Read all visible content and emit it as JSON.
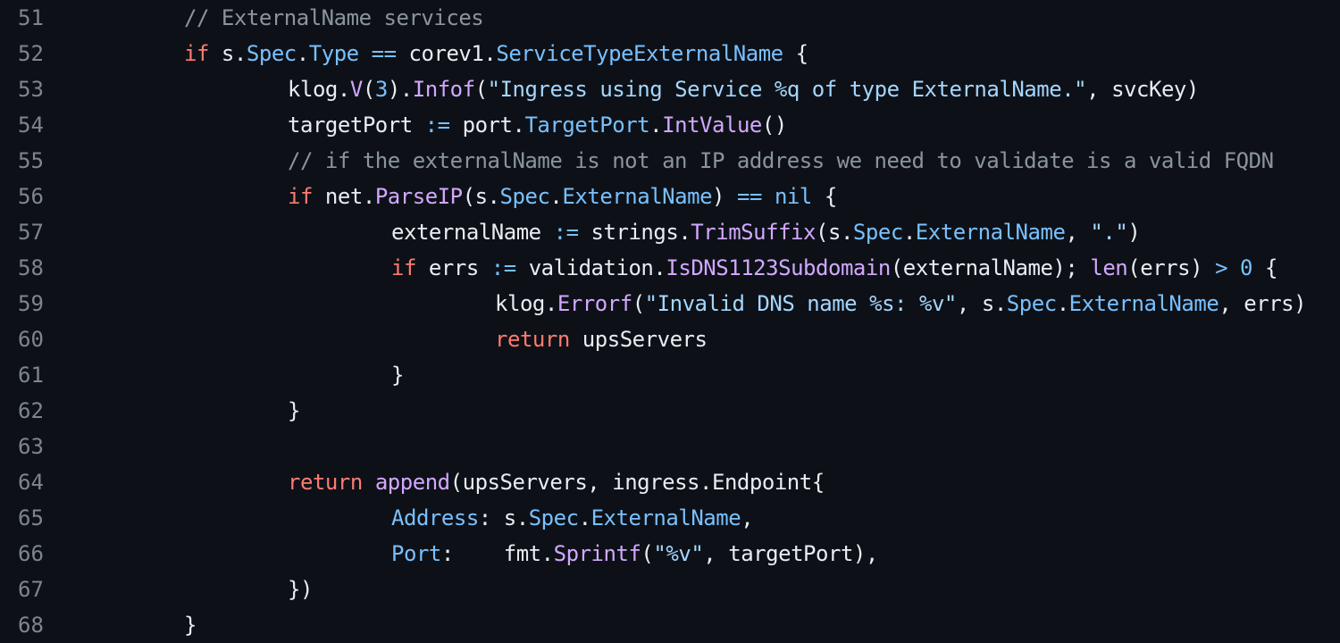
{
  "colors": {
    "background": "#0d1117",
    "line_number": "#7d8590",
    "plain": "#e6edf3",
    "comment": "#8b949e",
    "keyword": "#ff7b72",
    "operator": "#79c0ff",
    "type": "#79c0ff",
    "function": "#d2a8ff",
    "string": "#a5d6ff",
    "number": "#79c0ff"
  },
  "lines": [
    {
      "number": "51",
      "indent": 0,
      "tokens": [
        {
          "t": "// ExternalName services",
          "c": "comment"
        }
      ]
    },
    {
      "number": "52",
      "indent": 0,
      "tokens": [
        {
          "t": "if",
          "c": "keyword"
        },
        {
          "t": " s.",
          "c": "plain"
        },
        {
          "t": "Spec",
          "c": "type"
        },
        {
          "t": ".",
          "c": "plain"
        },
        {
          "t": "Type",
          "c": "type"
        },
        {
          "t": " ",
          "c": "plain"
        },
        {
          "t": "==",
          "c": "operator"
        },
        {
          "t": " corev1.",
          "c": "plain"
        },
        {
          "t": "ServiceTypeExternalName",
          "c": "type"
        },
        {
          "t": " {",
          "c": "plain"
        }
      ]
    },
    {
      "number": "53",
      "indent": 1,
      "tokens": [
        {
          "t": "klog.",
          "c": "plain"
        },
        {
          "t": "V",
          "c": "function"
        },
        {
          "t": "(",
          "c": "plain"
        },
        {
          "t": "3",
          "c": "number"
        },
        {
          "t": ").",
          "c": "plain"
        },
        {
          "t": "Infof",
          "c": "function"
        },
        {
          "t": "(",
          "c": "plain"
        },
        {
          "t": "\"Ingress using Service %q of type ExternalName.\"",
          "c": "string"
        },
        {
          "t": ", svcKey)",
          "c": "plain"
        }
      ]
    },
    {
      "number": "54",
      "indent": 1,
      "tokens": [
        {
          "t": "targetPort ",
          "c": "plain"
        },
        {
          "t": ":=",
          "c": "operator"
        },
        {
          "t": " port.",
          "c": "plain"
        },
        {
          "t": "TargetPort",
          "c": "type"
        },
        {
          "t": ".",
          "c": "plain"
        },
        {
          "t": "IntValue",
          "c": "function"
        },
        {
          "t": "()",
          "c": "plain"
        }
      ]
    },
    {
      "number": "55",
      "indent": 1,
      "tokens": [
        {
          "t": "// if the externalName is not an IP address we need to validate is a valid FQDN",
          "c": "comment"
        }
      ]
    },
    {
      "number": "56",
      "indent": 1,
      "tokens": [
        {
          "t": "if",
          "c": "keyword"
        },
        {
          "t": " net.",
          "c": "plain"
        },
        {
          "t": "ParseIP",
          "c": "function"
        },
        {
          "t": "(s.",
          "c": "plain"
        },
        {
          "t": "Spec",
          "c": "type"
        },
        {
          "t": ".",
          "c": "plain"
        },
        {
          "t": "ExternalName",
          "c": "type"
        },
        {
          "t": ") ",
          "c": "plain"
        },
        {
          "t": "==",
          "c": "operator"
        },
        {
          "t": " ",
          "c": "plain"
        },
        {
          "t": "nil",
          "c": "number"
        },
        {
          "t": " {",
          "c": "plain"
        }
      ]
    },
    {
      "number": "57",
      "indent": 2,
      "tokens": [
        {
          "t": "externalName ",
          "c": "plain"
        },
        {
          "t": ":=",
          "c": "operator"
        },
        {
          "t": " strings.",
          "c": "plain"
        },
        {
          "t": "TrimSuffix",
          "c": "function"
        },
        {
          "t": "(s.",
          "c": "plain"
        },
        {
          "t": "Spec",
          "c": "type"
        },
        {
          "t": ".",
          "c": "plain"
        },
        {
          "t": "ExternalName",
          "c": "type"
        },
        {
          "t": ", ",
          "c": "plain"
        },
        {
          "t": "\".\"",
          "c": "string"
        },
        {
          "t": ")",
          "c": "plain"
        }
      ]
    },
    {
      "number": "58",
      "indent": 2,
      "tokens": [
        {
          "t": "if",
          "c": "keyword"
        },
        {
          "t": " errs ",
          "c": "plain"
        },
        {
          "t": ":=",
          "c": "operator"
        },
        {
          "t": " validation.",
          "c": "plain"
        },
        {
          "t": "IsDNS1123Subdomain",
          "c": "function"
        },
        {
          "t": "(externalName); ",
          "c": "plain"
        },
        {
          "t": "len",
          "c": "function"
        },
        {
          "t": "(errs) ",
          "c": "plain"
        },
        {
          "t": ">",
          "c": "operator"
        },
        {
          "t": " ",
          "c": "plain"
        },
        {
          "t": "0",
          "c": "number"
        },
        {
          "t": " {",
          "c": "plain"
        }
      ]
    },
    {
      "number": "59",
      "indent": 3,
      "tokens": [
        {
          "t": "klog.",
          "c": "plain"
        },
        {
          "t": "Errorf",
          "c": "function"
        },
        {
          "t": "(",
          "c": "plain"
        },
        {
          "t": "\"Invalid DNS name %s: %v\"",
          "c": "string"
        },
        {
          "t": ", s.",
          "c": "plain"
        },
        {
          "t": "Spec",
          "c": "type"
        },
        {
          "t": ".",
          "c": "plain"
        },
        {
          "t": "ExternalName",
          "c": "type"
        },
        {
          "t": ", errs)",
          "c": "plain"
        }
      ]
    },
    {
      "number": "60",
      "indent": 3,
      "tokens": [
        {
          "t": "return",
          "c": "keyword"
        },
        {
          "t": " upsServers",
          "c": "plain"
        }
      ]
    },
    {
      "number": "61",
      "indent": 2,
      "tokens": [
        {
          "t": "}",
          "c": "plain"
        }
      ]
    },
    {
      "number": "62",
      "indent": 1,
      "tokens": [
        {
          "t": "}",
          "c": "plain"
        }
      ]
    },
    {
      "number": "63",
      "indent": 0,
      "tokens": []
    },
    {
      "number": "64",
      "indent": 1,
      "tokens": [
        {
          "t": "return",
          "c": "keyword"
        },
        {
          "t": " ",
          "c": "plain"
        },
        {
          "t": "append",
          "c": "function"
        },
        {
          "t": "(upsServers, ingress.Endpoint{",
          "c": "plain"
        }
      ]
    },
    {
      "number": "65",
      "indent": 2,
      "tokens": [
        {
          "t": "Address",
          "c": "type"
        },
        {
          "t": ": s.",
          "c": "plain"
        },
        {
          "t": "Spec",
          "c": "type"
        },
        {
          "t": ".",
          "c": "plain"
        },
        {
          "t": "ExternalName",
          "c": "type"
        },
        {
          "t": ",",
          "c": "plain"
        }
      ]
    },
    {
      "number": "66",
      "indent": 2,
      "tokens": [
        {
          "t": "Port",
          "c": "type"
        },
        {
          "t": ":    fmt.",
          "c": "plain"
        },
        {
          "t": "Sprintf",
          "c": "function"
        },
        {
          "t": "(",
          "c": "plain"
        },
        {
          "t": "\"%v\"",
          "c": "string"
        },
        {
          "t": ", targetPort),",
          "c": "plain"
        }
      ]
    },
    {
      "number": "67",
      "indent": 1,
      "tokens": [
        {
          "t": "})",
          "c": "plain"
        }
      ]
    },
    {
      "number": "68",
      "indent": 0,
      "tokens": [
        {
          "t": "}",
          "c": "plain"
        }
      ]
    }
  ]
}
